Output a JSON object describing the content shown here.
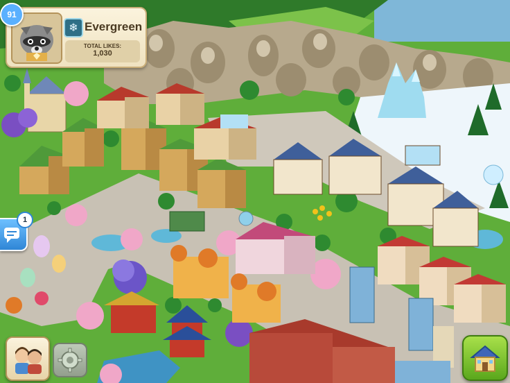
{
  "hud": {
    "level": "91",
    "town_name": "Evergreen",
    "likes_label": "TOTAL LIKES:",
    "likes_value": "1,030",
    "avatar": "raccoon-mayor-avatar",
    "town_badge_icon": "snowflake-icon"
  },
  "chat": {
    "unread_count": "1",
    "icon": "chat-bubble-icon"
  },
  "buttons": {
    "friends_icon": "friends-avatars-icon",
    "settings_icon": "gear-icon",
    "build_icon": "house-build-icon"
  },
  "colors": {
    "grass": "#5fae3a",
    "road": "#c8c1b4",
    "rock": "#b7a98d",
    "snow": "#eef6fb",
    "hud_panel": "#fbf3dd",
    "level_badge": "#5ab0ff",
    "build_button": "#6bb52a"
  }
}
